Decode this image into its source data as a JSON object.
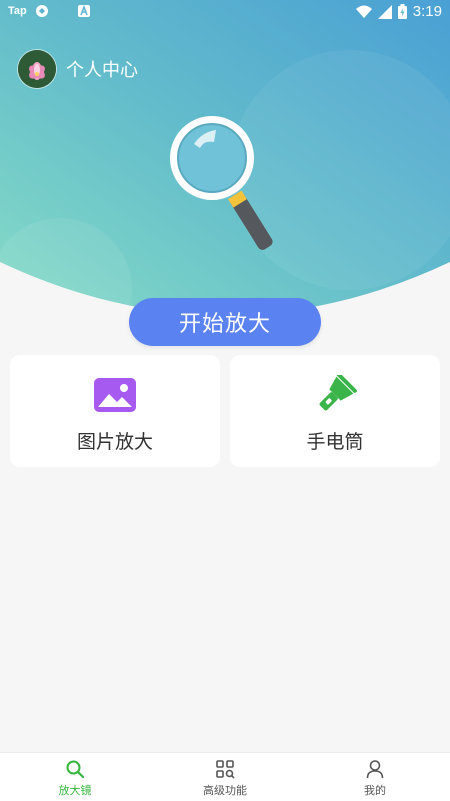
{
  "status_bar": {
    "carrier_label": "Tap",
    "time": "3:19",
    "icons": [
      "tap-app-icon",
      "sync-icon",
      "a-app-icon",
      "wifi-icon",
      "signal-icon",
      "battery-icon"
    ]
  },
  "header": {
    "profile_label": "个人中心",
    "avatar": "lotus-avatar"
  },
  "hero": {
    "start_button_label": "开始放大",
    "illustration": "magnifier-illustration"
  },
  "features": [
    {
      "label": "图片放大",
      "icon": "image-icon",
      "color": "#a65af0"
    },
    {
      "label": "手电筒",
      "icon": "flashlight-icon",
      "color": "#3bb54a"
    }
  ],
  "tabbar": {
    "tabs": [
      {
        "label": "放大镜",
        "icon": "search-icon",
        "active": true
      },
      {
        "label": "高级功能",
        "icon": "grid-search-icon",
        "active": false
      },
      {
        "label": "我的",
        "icon": "user-icon",
        "active": false
      }
    ]
  },
  "colors": {
    "accent": "#5a82f0",
    "active_tab": "#35b53e",
    "hero_gradient_start": "#7fd6c2",
    "hero_gradient_end": "#4fa3d6"
  }
}
